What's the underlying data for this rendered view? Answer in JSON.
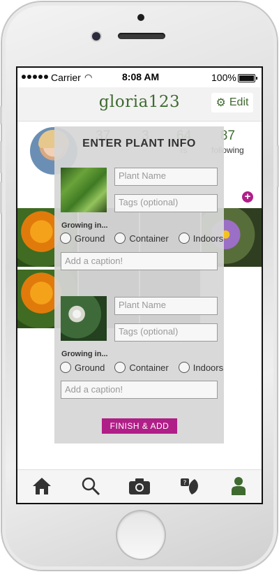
{
  "status_bar": {
    "carrier": "Carrier",
    "time": "8:08 AM",
    "battery": "100%"
  },
  "header": {
    "username": "gloria123",
    "edit_label": "Edit"
  },
  "profile": {
    "stats": [
      {
        "value": "37",
        "label": ""
      },
      {
        "value": "3",
        "label": ""
      },
      {
        "value": "64",
        "label": "rs"
      },
      {
        "value": "87",
        "label": "following"
      }
    ]
  },
  "modal": {
    "title": "ENTER PLANT INFO",
    "growing_label": "Growing in...",
    "radio_options": [
      "Ground",
      "Container",
      "Indoors"
    ],
    "plants": [
      {
        "name_placeholder": "Plant Name",
        "tags_placeholder": "Tags (optional)",
        "caption_placeholder": "Add a caption!"
      },
      {
        "name_placeholder": "Plant Name",
        "tags_placeholder": "Tags (optional)",
        "caption_placeholder": "Add a caption!"
      }
    ],
    "finish_label": "FINISH & ADD"
  },
  "tabbar": {
    "icons": [
      "home-icon",
      "search-icon",
      "camera-icon",
      "plant-help-icon",
      "profile-icon"
    ],
    "active_color": "#3f6a30"
  },
  "colors": {
    "brand_green": "#3f6a30",
    "accent_magenta": "#b01e87"
  }
}
